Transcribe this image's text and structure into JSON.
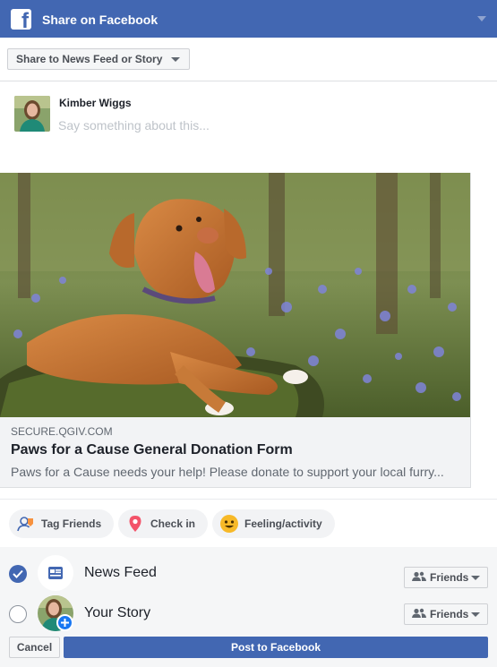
{
  "window": {
    "title": "Share on Facebook",
    "brand_color": "#4267b2",
    "logo_letter": "f"
  },
  "share_target": {
    "label": "Share to News Feed or Story"
  },
  "composer": {
    "user_name": "Kimber Wiggs",
    "placeholder": "Say something about this...",
    "value": ""
  },
  "link_preview": {
    "image_description": "dog-photo",
    "domain": "SECURE.QGIV.COM",
    "title": "Paws for a Cause General Donation Form",
    "description": "Paws for a Cause needs your help! Please donate to support your local furry..."
  },
  "actions": [
    {
      "label": "Tag Friends",
      "icon": "tag-friends-icon"
    },
    {
      "label": "Check in",
      "icon": "location-pin-icon"
    },
    {
      "label": "Feeling/activity",
      "icon": "smiley-icon"
    }
  ],
  "destinations": [
    {
      "label": "News Feed",
      "checked": true,
      "icon": "news-feed-icon",
      "audience": "Friends"
    },
    {
      "label": "Your Story",
      "checked": false,
      "icon": "story-avatar-icon",
      "audience": "Friends"
    }
  ],
  "footer": {
    "cancel_label": "Cancel",
    "post_label": "Post to Facebook"
  }
}
